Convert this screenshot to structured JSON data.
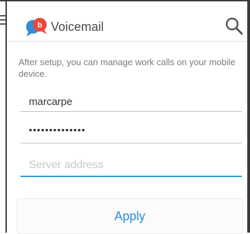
{
  "app": {
    "title": "Voicemail",
    "logo_badge": "b",
    "colors": {
      "accent": "#2c9ad6",
      "logo_red": "#e8493b",
      "logo_blue": "#2f8fd8"
    }
  },
  "header": {
    "menu_icon": "hamburger-menu-icon",
    "search_icon": "search-icon"
  },
  "setup": {
    "description": "After setup, you can manage work calls on your mobile device.",
    "username": "marcarpe",
    "password_mask": "••••••••••••••",
    "server_placeholder": "Server address",
    "server_value": ""
  },
  "actions": {
    "apply_label": "Apply"
  }
}
